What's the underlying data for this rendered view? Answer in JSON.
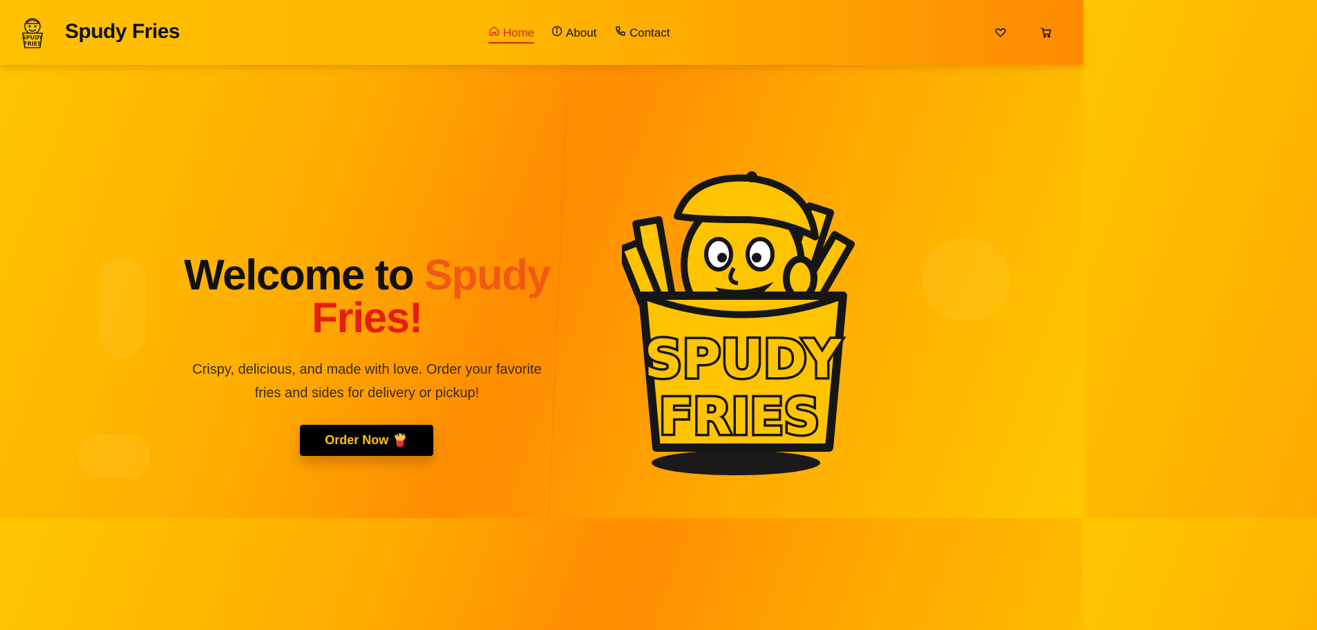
{
  "header": {
    "brand": "Spudy Fries",
    "logo_text": [
      "SPUDY",
      "FRIES"
    ],
    "nav": [
      {
        "label": "Home",
        "icon": "home-icon",
        "active": true
      },
      {
        "label": "About",
        "icon": "info-icon"
      },
      {
        "label": "Contact",
        "icon": "phone-icon"
      }
    ],
    "actions": [
      {
        "icon": "heart-icon"
      },
      {
        "icon": "cart-icon"
      }
    ]
  },
  "hero": {
    "title_prefix": "Welcome to ",
    "title_accent_1": "Spudy",
    "title_accent_2": "Fries!",
    "subtitle": "Crispy, delicious, and made with love. Order your favorite fries and sides for delivery or pickup!",
    "cta_label": "Order Now",
    "cta_emoji": "🍟",
    "mascot_text": [
      "SPUDY",
      "FRIES"
    ]
  },
  "colors": {
    "accent_orange": "#f05a14",
    "accent_red": "#e51e10",
    "active_nav": "#d7260a",
    "cta_bg": "#000000",
    "cta_text": "#ffc21a"
  }
}
